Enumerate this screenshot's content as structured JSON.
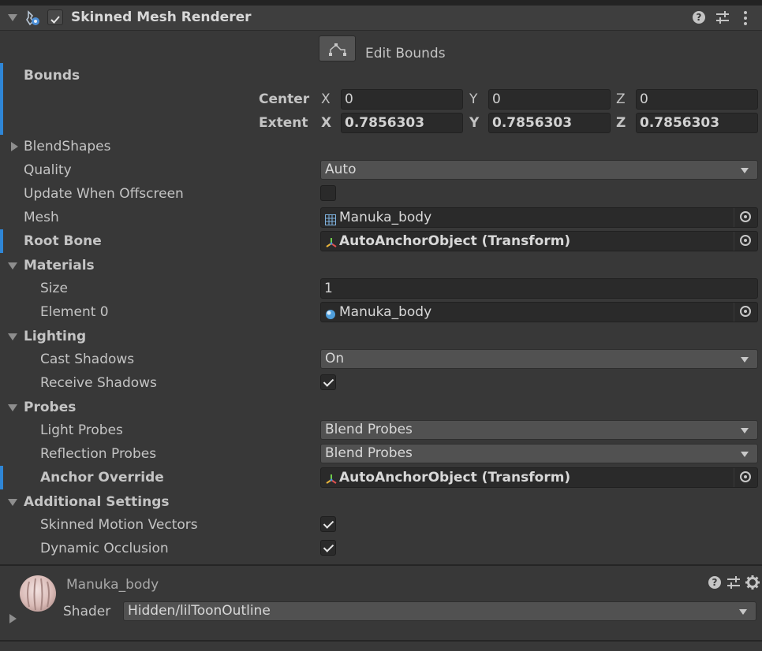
{
  "header": {
    "title": "Skinned Mesh Renderer",
    "enabled": true
  },
  "edit_bounds": {
    "label": "Edit Bounds"
  },
  "bounds": {
    "label": "Bounds",
    "center": {
      "label": "Center",
      "x_label": "X",
      "x": "0",
      "y_label": "Y",
      "y": "0",
      "z_label": "Z",
      "z": "0"
    },
    "extent": {
      "label": "Extent",
      "x_label": "X",
      "x": "0.7856303",
      "y_label": "Y",
      "y": "0.7856303",
      "z_label": "Z",
      "z": "0.7856303"
    }
  },
  "blendshapes": {
    "label": "BlendShapes"
  },
  "quality": {
    "label": "Quality",
    "value": "Auto"
  },
  "update_when_offscreen": {
    "label": "Update When Offscreen",
    "checked": false
  },
  "mesh": {
    "label": "Mesh",
    "value": "Manuka_body"
  },
  "root_bone": {
    "label": "Root Bone",
    "value": "AutoAnchorObject (Transform)"
  },
  "materials": {
    "label": "Materials",
    "size_label": "Size",
    "size_value": "1",
    "element0_label": "Element 0",
    "element0_value": "Manuka_body"
  },
  "lighting": {
    "label": "Lighting",
    "cast_shadows_label": "Cast Shadows",
    "cast_shadows_value": "On",
    "receive_shadows_label": "Receive Shadows",
    "receive_shadows_checked": true
  },
  "probes": {
    "label": "Probes",
    "light_probes_label": "Light Probes",
    "light_probes_value": "Blend Probes",
    "reflection_probes_label": "Reflection Probes",
    "reflection_probes_value": "Blend Probes",
    "anchor_override_label": "Anchor Override",
    "anchor_override_value": "AutoAnchorObject (Transform)"
  },
  "additional_settings": {
    "label": "Additional Settings",
    "skinned_motion_vectors_label": "Skinned Motion Vectors",
    "skinned_motion_vectors_checked": true,
    "dynamic_occlusion_label": "Dynamic Occlusion",
    "dynamic_occlusion_checked": true
  },
  "material_panel": {
    "name": "Manuka_body",
    "shader_label": "Shader",
    "shader_value": "Hidden/lilToonOutline"
  },
  "icons": {
    "help": "help-icon",
    "preset": "preset-sliders-icon",
    "menu": "kebab-menu-icon",
    "settings": "gear-icon"
  },
  "colors": {
    "background": "#383838",
    "selection_bar": "#2f86d6",
    "field": "#2a2a2a",
    "dropdown": "#515151"
  }
}
